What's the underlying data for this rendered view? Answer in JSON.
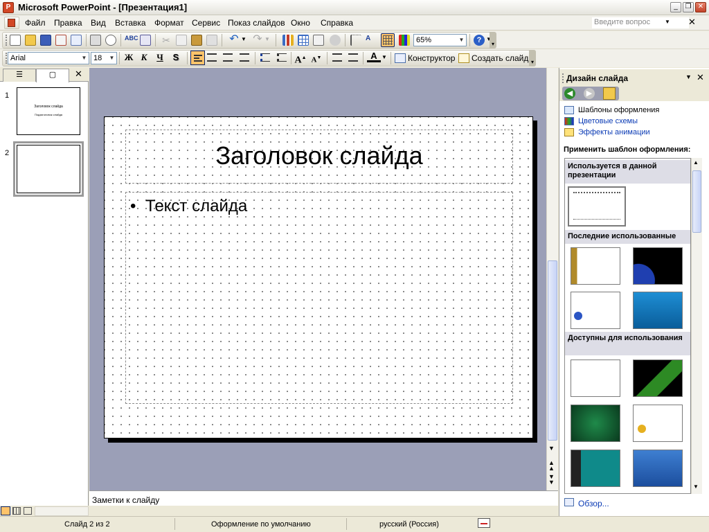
{
  "window": {
    "title": "Microsoft PowerPoint - [Презентация1]",
    "app_icon": "powerpoint-icon"
  },
  "menu": {
    "items": [
      "Файл",
      "Правка",
      "Вид",
      "Вставка",
      "Формат",
      "Сервис",
      "Показ слайдов",
      "Окно",
      "Справка"
    ],
    "ask_placeholder": "Введите вопрос"
  },
  "toolbar": {
    "zoom": "65%"
  },
  "format_toolbar": {
    "font": "Arial",
    "size": "18",
    "bold": "Ж",
    "italic": "К",
    "underline": "Ч",
    "shadow": "S",
    "designer_label": "Конструктор",
    "new_slide_label": "Создать слайд"
  },
  "slides_panel": {
    "thumbs": [
      {
        "number": "1",
        "title": "Заголовок слайда",
        "subtitle": "Подзаголовок слайда"
      },
      {
        "number": "2"
      }
    ]
  },
  "slide": {
    "title": "Заголовок слайда",
    "bullet": "•",
    "body": "Текст слайда"
  },
  "notes": {
    "placeholder": "Заметки к слайду"
  },
  "task_pane": {
    "title": "Дизайн слайда",
    "links": [
      "Шаблоны оформления",
      "Цветовые схемы",
      "Эффекты анимации"
    ],
    "apply_label": "Применить шаблон оформления:",
    "sections": [
      "Используется в данной презентации",
      "Последние использованные",
      "Доступны для использования"
    ],
    "browse": "Обзор..."
  },
  "status": {
    "slide": "Слайд 2 из 2",
    "design": "Оформление по умолчанию",
    "language": "русский (Россия)"
  },
  "colors": {
    "slide_area": "#9b9fb7",
    "chrome": "#ece9d8",
    "link": "#0b3bb5",
    "accent": "#d24726"
  }
}
